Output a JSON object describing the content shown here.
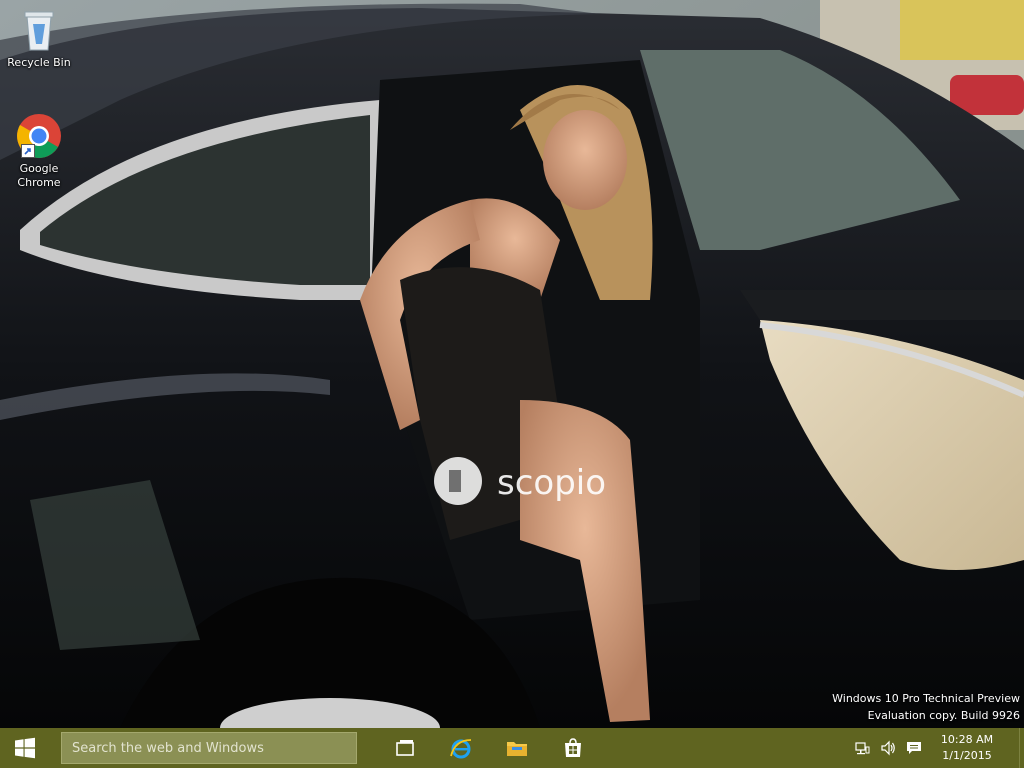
{
  "desktop": {
    "icons": [
      {
        "label": "Recycle Bin",
        "icon": "recycle-bin-icon"
      },
      {
        "label": "Google\nChrome",
        "icon": "chrome-icon"
      }
    ],
    "wallpaper_watermark": "scopio",
    "os_watermark": {
      "line1": "Windows 10 Pro Technical Preview",
      "line2": "Evaluation copy. Build 9926"
    }
  },
  "taskbar": {
    "start_icon": "windows-logo-icon",
    "search_placeholder": "Search the web and Windows",
    "pinned": [
      {
        "icon": "task-view-icon"
      },
      {
        "icon": "internet-explorer-icon"
      },
      {
        "icon": "file-explorer-icon"
      },
      {
        "icon": "store-icon"
      }
    ],
    "tray": {
      "icons": [
        "network-icon",
        "volume-icon",
        "action-center-icon"
      ],
      "time": "10:28 AM",
      "date": "1/1/2015"
    },
    "colors": {
      "taskbar": "#5f6420",
      "search_box": "#8b9054"
    }
  }
}
